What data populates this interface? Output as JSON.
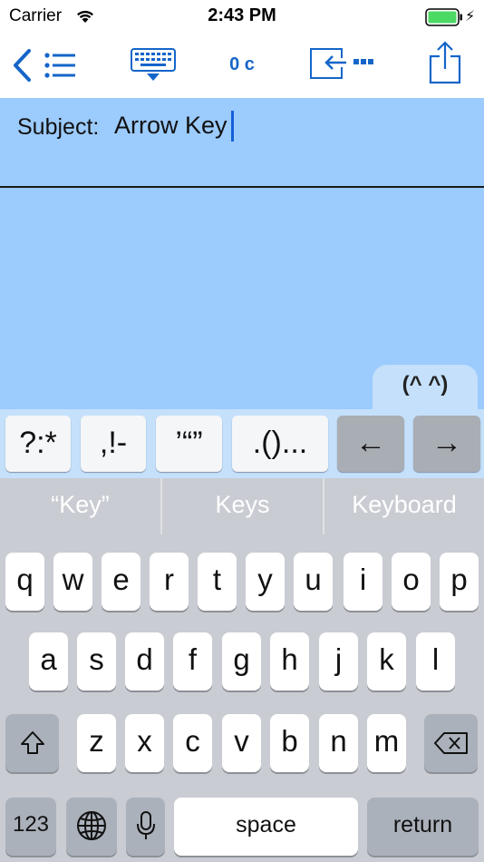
{
  "status_bar": {
    "carrier": "Carrier",
    "time": "2:43 PM",
    "icons": [
      "wifi-icon",
      "battery-icon",
      "charging-icon"
    ],
    "charging_glyph": "⚡"
  },
  "toolbar": {
    "icons": [
      "back-list-icon",
      "keyboard-dismiss-icon",
      "insert-icon",
      "share-icon"
    ],
    "char_count": "0 c",
    "accent_color": "#1565c9"
  },
  "editor": {
    "subject_label": "Subject:",
    "subject_value": "Arrow Key",
    "background_color": "#9ccbfd"
  },
  "emoticon_tab": {
    "label": "(^ ^)"
  },
  "accessory_keys": [
    {
      "label": "?:*"
    },
    {
      "label": ",!-"
    },
    {
      "label": "’“”"
    },
    {
      "label": ".()..."
    },
    {
      "label": "←"
    },
    {
      "label": "→"
    }
  ],
  "suggestions": [
    "“Key”",
    "Keys",
    "Keyboard"
  ],
  "keyboard": {
    "row1": [
      "q",
      "w",
      "e",
      "r",
      "t",
      "y",
      "u",
      "i",
      "o",
      "p"
    ],
    "row2": [
      "a",
      "s",
      "d",
      "f",
      "g",
      "h",
      "j",
      "k",
      "l"
    ],
    "row3": [
      "z",
      "x",
      "c",
      "v",
      "b",
      "n",
      "m"
    ],
    "numbers_label": "123",
    "space_label": "space",
    "return_label": "return",
    "icons": [
      "shift-icon",
      "delete-icon",
      "globe-icon",
      "microphone-icon"
    ]
  }
}
